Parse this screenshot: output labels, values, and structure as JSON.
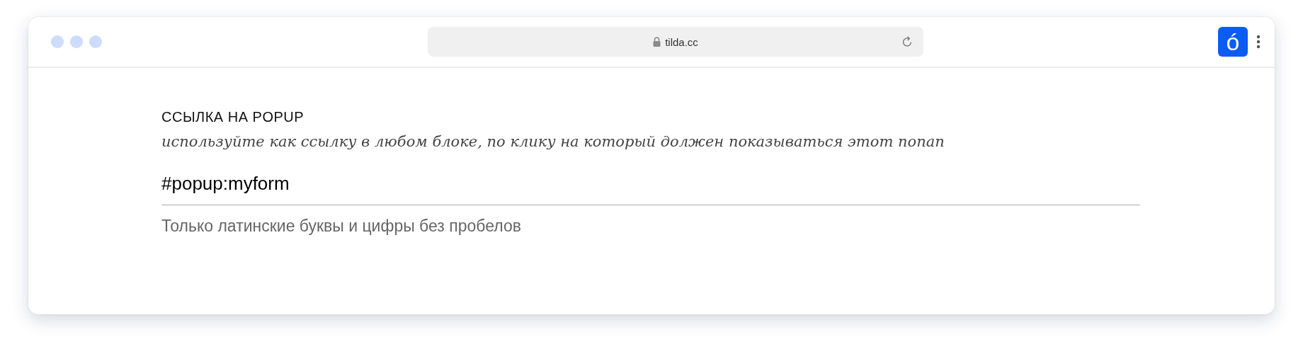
{
  "browser": {
    "url": "tilda.cc",
    "extension_badge": "ó"
  },
  "field": {
    "label": "ССЫЛКА НА POPUP",
    "description": "используйте как ссылку в любом блоке, по клику на который должен показываться этот попап",
    "value": "#popup:myform",
    "hint": "Только латинские буквы и цифры без пробелов"
  }
}
